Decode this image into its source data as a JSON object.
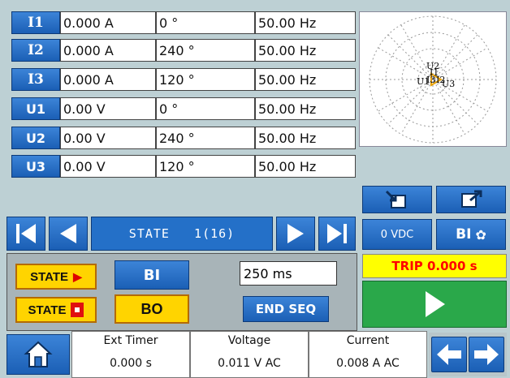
{
  "channels": [
    {
      "name": "I1",
      "magnitude": "0.000 A",
      "phase": "0 °",
      "frequency": "50.00 Hz"
    },
    {
      "name": "I2",
      "magnitude": "0.000 A",
      "phase": "240 °",
      "frequency": "50.00 Hz"
    },
    {
      "name": "I3",
      "magnitude": "0.000 A",
      "phase": "120 °",
      "frequency": "50.00 Hz"
    },
    {
      "name": "U1",
      "magnitude": "0.00 V",
      "phase": "0 °",
      "frequency": "50.00 Hz"
    },
    {
      "name": "U2",
      "magnitude": "0.00 V",
      "phase": "240 °",
      "frequency": "50.00 Hz"
    },
    {
      "name": "U3",
      "magnitude": "0.00 V",
      "phase": "120 °",
      "frequency": "50.00 Hz"
    }
  ],
  "phasor": {
    "labels": [
      "U2",
      "I1",
      "U1",
      "I3",
      "I2",
      "U3"
    ]
  },
  "toolbar": {
    "open_icon": "open-file-icon",
    "save_icon": "save-file-icon"
  },
  "navigation": {
    "state_text": "STATE   1(16)"
  },
  "dc": {
    "label": "0 VDC"
  },
  "bi_settings": {
    "label": "BI"
  },
  "trip": {
    "label": "TRIP 0.000 s",
    "color": "#ff0000",
    "bg": "#ffff00"
  },
  "controls": {
    "state_next_label": "STATE",
    "state_stop_label": "STATE",
    "bi_label": "BI",
    "bo_label": "BO",
    "time_value": "250 ms",
    "end_seq_label": "END SEQ"
  },
  "start": {
    "color": "#2aa84a"
  },
  "meters": [
    {
      "title": "Ext Timer",
      "value": "0.000 s"
    },
    {
      "title": "Voltage",
      "value": "0.011 V AC"
    },
    {
      "title": "Current",
      "value": "0.008 A AC"
    }
  ]
}
